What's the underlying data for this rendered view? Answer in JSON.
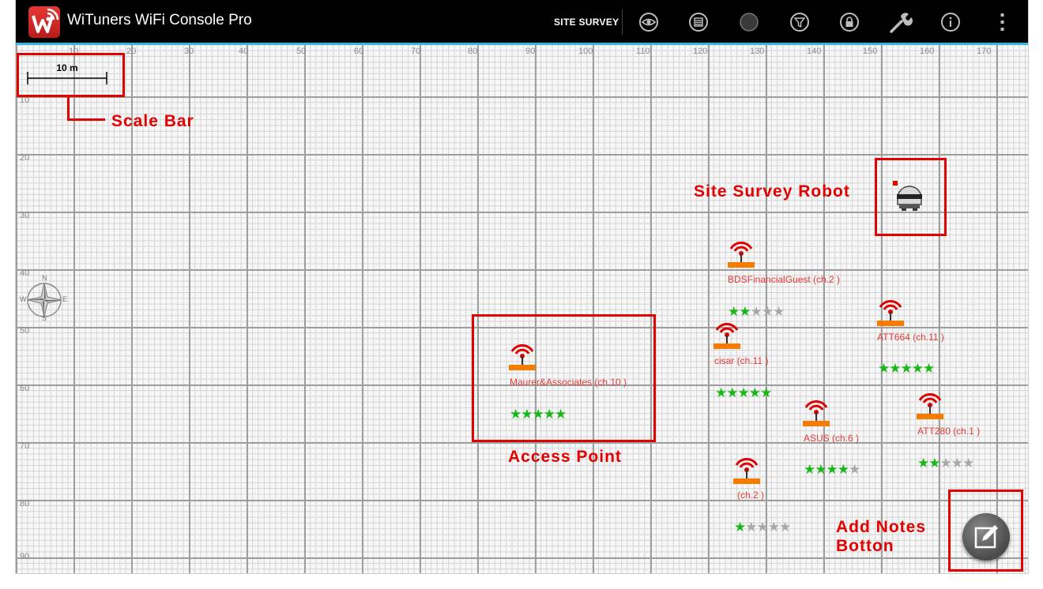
{
  "app": {
    "title": "WiTuners WiFi Console Pro"
  },
  "toolbar": {
    "site_survey_label": "SITE SURVEY",
    "actions": [
      "eye-icon",
      "list-icon",
      "record-icon",
      "filter-icon",
      "lock-icon",
      "wrench-icon",
      "info-icon",
      "overflow-menu-icon"
    ]
  },
  "map": {
    "x_ticks": [
      "10",
      "20",
      "30",
      "40",
      "50",
      "60",
      "70",
      "80",
      "90",
      "100",
      "110",
      "120",
      "130",
      "140",
      "150",
      "160",
      "170"
    ],
    "y_ticks": [
      "10",
      "20",
      "30",
      "40",
      "50",
      "60",
      "70",
      "80",
      "90"
    ],
    "scale_bar_label": "10 m",
    "compass": {
      "n": "N",
      "s": "S",
      "e": "E",
      "w": "W"
    }
  },
  "access_points": [
    {
      "name": "BDSFinancialGuest (ch.2 )",
      "stars": 2
    },
    {
      "name": "ATT664 (ch.11 )",
      "stars": 5
    },
    {
      "name": "cisar (ch.11 )",
      "stars": 5
    },
    {
      "name": "Maurer&Associates (ch.10 )",
      "stars": 5
    },
    {
      "name": "ASUS (ch.6 )",
      "stars": 4
    },
    {
      "name": "ATT280 (ch.1 )",
      "stars": 2
    },
    {
      "name": "(ch.2 )",
      "stars": 1
    }
  ],
  "annotations": {
    "scale_bar": "Scale Bar",
    "site_survey_robot": "Site Survey Robot",
    "access_point": "Access Point",
    "add_notes_line1": "Add Notes",
    "add_notes_line2": "Botton"
  },
  "colors": {
    "accent": "#33b5e5",
    "annotation": "#e30000",
    "ap_label": "#e53935",
    "star_on": "#18b818",
    "star_off": "#a8a8a8"
  }
}
